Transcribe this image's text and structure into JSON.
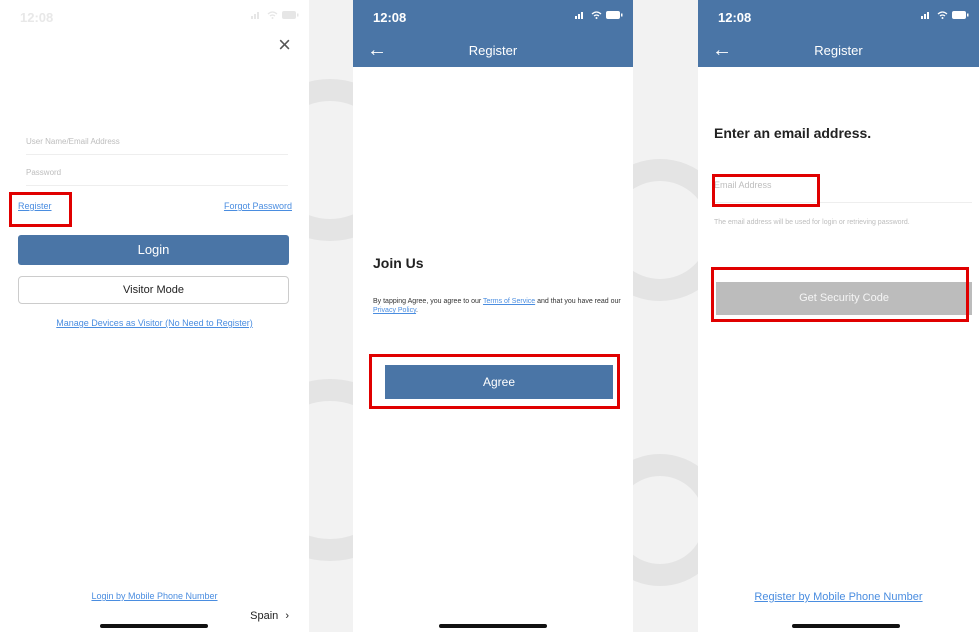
{
  "status": {
    "time": "12:08"
  },
  "screen1": {
    "username_placeholder": "User Name/Email Address",
    "password_placeholder": "Password",
    "register_link": "Register",
    "forgot_link": "Forgot Password",
    "login_label": "Login",
    "visitor_label": "Visitor Mode",
    "manage_link": "Manage Devices as Visitor (No Need to Register)",
    "phone_login_link": "Login by Mobile Phone Number",
    "region": "Spain",
    "region_chevron": "›"
  },
  "screen2": {
    "title": "Register",
    "heading": "Join Us",
    "text_before": "By tapping Agree, you agree to our ",
    "terms_link": "Terms of Service",
    "text_middle": " and that you have read our ",
    "privacy_link": "Privacy Policy",
    "text_end": ".",
    "agree_label": "Agree"
  },
  "screen3": {
    "title": "Register",
    "heading": "Enter an email address.",
    "email_placeholder": "Email Address",
    "hint": "The email address will be used for login or retrieving password.",
    "security_label": "Get Security Code",
    "phone_register_link": "Register by Mobile Phone Number"
  },
  "colors": {
    "header": "#4a75a6",
    "link": "#4a8de0",
    "highlight": "#e00000",
    "disabled": "#bcbcbc"
  },
  "icons": [
    "signal-icon",
    "wifi-icon",
    "battery-icon",
    "back-arrow-icon",
    "close-icon"
  ]
}
